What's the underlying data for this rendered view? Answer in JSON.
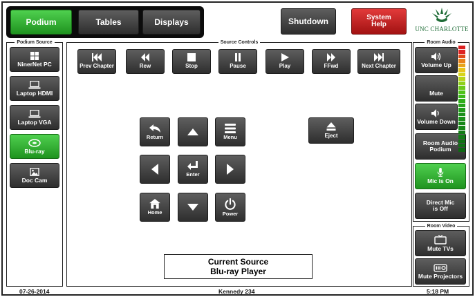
{
  "nav": {
    "tabs": [
      {
        "label": "Podium",
        "active": true
      },
      {
        "label": "Tables",
        "active": false
      },
      {
        "label": "Displays",
        "active": false
      }
    ],
    "shutdown_label": "Shutdown",
    "help_label": [
      "System",
      "Help"
    ]
  },
  "logo": {
    "text": "UNC CHARLOTTE",
    "icon": "crown-logo-icon"
  },
  "podium_source": {
    "title": "Podium Source",
    "items": [
      {
        "label": "NinerNet PC",
        "icon": "windows-icon",
        "active": false
      },
      {
        "label": "Laptop HDMI",
        "icon": "laptop-icon",
        "active": false
      },
      {
        "label": "Laptop VGA",
        "icon": "laptop-icon",
        "active": false
      },
      {
        "label": "Blu-ray",
        "icon": "disc-icon",
        "active": true
      },
      {
        "label": "Doc Cam",
        "icon": "image-icon",
        "active": false
      }
    ]
  },
  "source_controls": {
    "title": "Source Controls",
    "transport": [
      {
        "label": "Prev Chapter",
        "icon": "skip-back-icon"
      },
      {
        "label": "Rew",
        "icon": "rewind-icon"
      },
      {
        "label": "Stop",
        "icon": "stop-icon"
      },
      {
        "label": "Pause",
        "icon": "pause-icon"
      },
      {
        "label": "Play",
        "icon": "play-icon"
      },
      {
        "label": "FFwd",
        "icon": "fast-forward-icon"
      },
      {
        "label": "Next Chapter",
        "icon": "skip-forward-icon"
      }
    ],
    "dpad": {
      "return": "Return",
      "menu": "Menu",
      "enter": "Enter",
      "home": "Home",
      "power": "Power"
    },
    "eject": "Eject",
    "current_source_label": "Current Source",
    "current_source_value": "Blu-ray Player"
  },
  "room_audio": {
    "title": "Room Audio",
    "volume_up": "Volume Up",
    "mute": "Mute",
    "volume_down": "Volume Down",
    "room_audio_podium": [
      "Room Audio",
      "Podium"
    ],
    "mic_on": "Mic is On",
    "direct_mic": [
      "Direct Mic",
      "is Off"
    ]
  },
  "room_video": {
    "title": "Room Video",
    "mute_tvs": "Mute TVs",
    "mute_projectors": "Mute Projectors"
  },
  "status": {
    "date": "07-26-2014",
    "room": "Kennedy 234",
    "time": "5:18 PM"
  },
  "colors": {
    "active_green": "#2fae2f",
    "help_red": "#c41e1e",
    "button_gray": "#454545",
    "brand_green": "#1d6b35"
  }
}
